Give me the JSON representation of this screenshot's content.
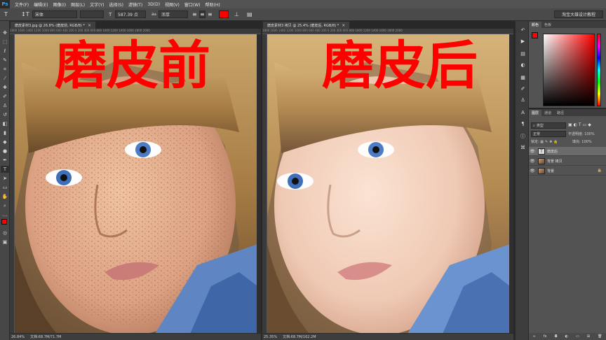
{
  "app": {
    "logo": "Ps"
  },
  "menu": [
    "文件(F)",
    "编辑(E)",
    "图像(I)",
    "图层(L)",
    "文字(Y)",
    "选择(S)",
    "滤镜(T)",
    "3D(D)",
    "视图(V)",
    "窗口(W)",
    "帮助(H)"
  ],
  "options": {
    "tool_glyph": "T",
    "orient_glyph": "↕T",
    "font_family": "宋体",
    "font_size": "587.39 点",
    "antialias": "浑厚",
    "align_glyphs": [
      "≡",
      "≡",
      "≡"
    ],
    "text_color": "#ff0000",
    "warp_glyph": "⊥",
    "panel_glyph": "▤",
    "workspace": "淘宝大雄设计教程"
  },
  "docs": [
    {
      "tab": "磨皮素材3.jpg @ 26.8% (磨皮前, RGB/8) *",
      "overlay": "磨皮前",
      "ruler": "1800 1600 1400 1200 1000 800 600 400 200 0 200 400 600 800 1000 1200 1400 1600 1800 2000",
      "zoom": "26.84%",
      "docsize": "文档:68.7M/71.7M"
    },
    {
      "tab": "磨皮素材3 拷贝 @ 25.4% (磨皮后, RGB/8) *",
      "overlay": "磨皮后",
      "ruler": "1800 1600 1400 1200 1000 800 600 400 200 0 200 400 600 800 1000 1200 1400 1600 1800 2000",
      "zoom": "25.35%",
      "docsize": "文档:68.7M/162.2M"
    }
  ],
  "color_panel": {
    "tabs": [
      "颜色",
      "色板"
    ],
    "foreground": "#ff0000",
    "background": "#ffffff"
  },
  "layers_panel": {
    "tabs": [
      "图层",
      "通道",
      "路径"
    ],
    "filter": "类型",
    "blend": "正常",
    "opacity_label": "不透明度:",
    "opacity": "100%",
    "lock_label": "锁定:",
    "fill_label": "填充:",
    "fill": "100%",
    "layers": [
      {
        "name": "磨皮后",
        "type": "text",
        "selected": true
      },
      {
        "name": "背景 拷贝",
        "type": "image",
        "selected": false
      },
      {
        "name": "背景",
        "type": "image",
        "selected": false
      }
    ],
    "footer_icons": [
      "link-icon",
      "fx-icon",
      "mask-icon",
      "adjust-icon",
      "folder-icon",
      "new-layer-icon",
      "trash-icon"
    ]
  }
}
